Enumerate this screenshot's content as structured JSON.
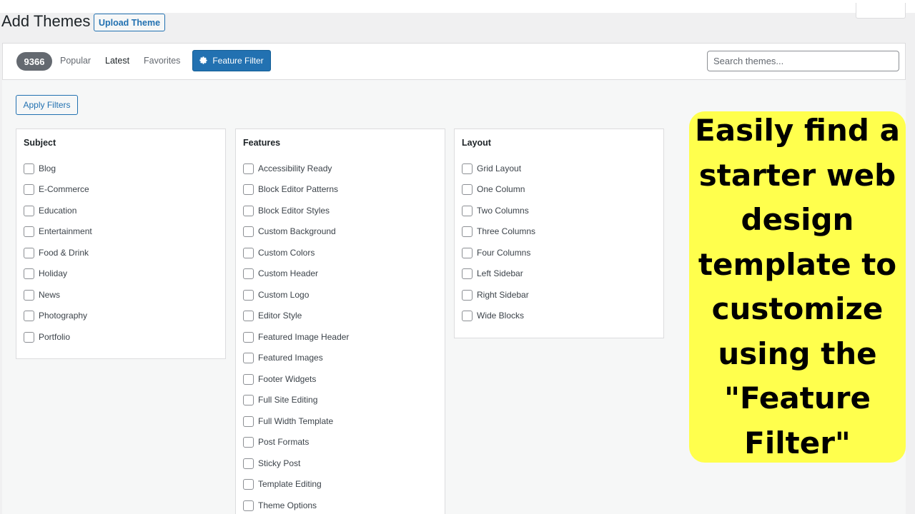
{
  "header": {
    "title": "Add Themes",
    "upload_label": "Upload Theme"
  },
  "filter_bar": {
    "count": "9366",
    "links": [
      "Popular",
      "Latest",
      "Favorites"
    ],
    "current_link": "Latest",
    "feature_filter_label": "Feature Filter",
    "search_placeholder": "Search themes..."
  },
  "drawer": {
    "apply_label": "Apply Filters",
    "groups": [
      {
        "title": "Subject",
        "options": [
          "Blog",
          "E-Commerce",
          "Education",
          "Entertainment",
          "Food & Drink",
          "Holiday",
          "News",
          "Photography",
          "Portfolio"
        ]
      },
      {
        "title": "Features",
        "options": [
          "Accessibility Ready",
          "Block Editor Patterns",
          "Block Editor Styles",
          "Custom Background",
          "Custom Colors",
          "Custom Header",
          "Custom Logo",
          "Editor Style",
          "Featured Image Header",
          "Featured Images",
          "Footer Widgets",
          "Full Site Editing",
          "Full Width Template",
          "Post Formats",
          "Sticky Post",
          "Template Editing",
          "Theme Options"
        ]
      },
      {
        "title": "Layout",
        "options": [
          "Grid Layout",
          "One Column",
          "Two Columns",
          "Three Columns",
          "Four Columns",
          "Left Sidebar",
          "Right Sidebar",
          "Wide Blocks"
        ]
      }
    ]
  },
  "callout": {
    "text": "Easily find a starter web design template to customize using the \"Feature Filter\"",
    "background": "#ffff4d"
  },
  "colors": {
    "accent": "#2271b1",
    "badge": "#646970"
  }
}
